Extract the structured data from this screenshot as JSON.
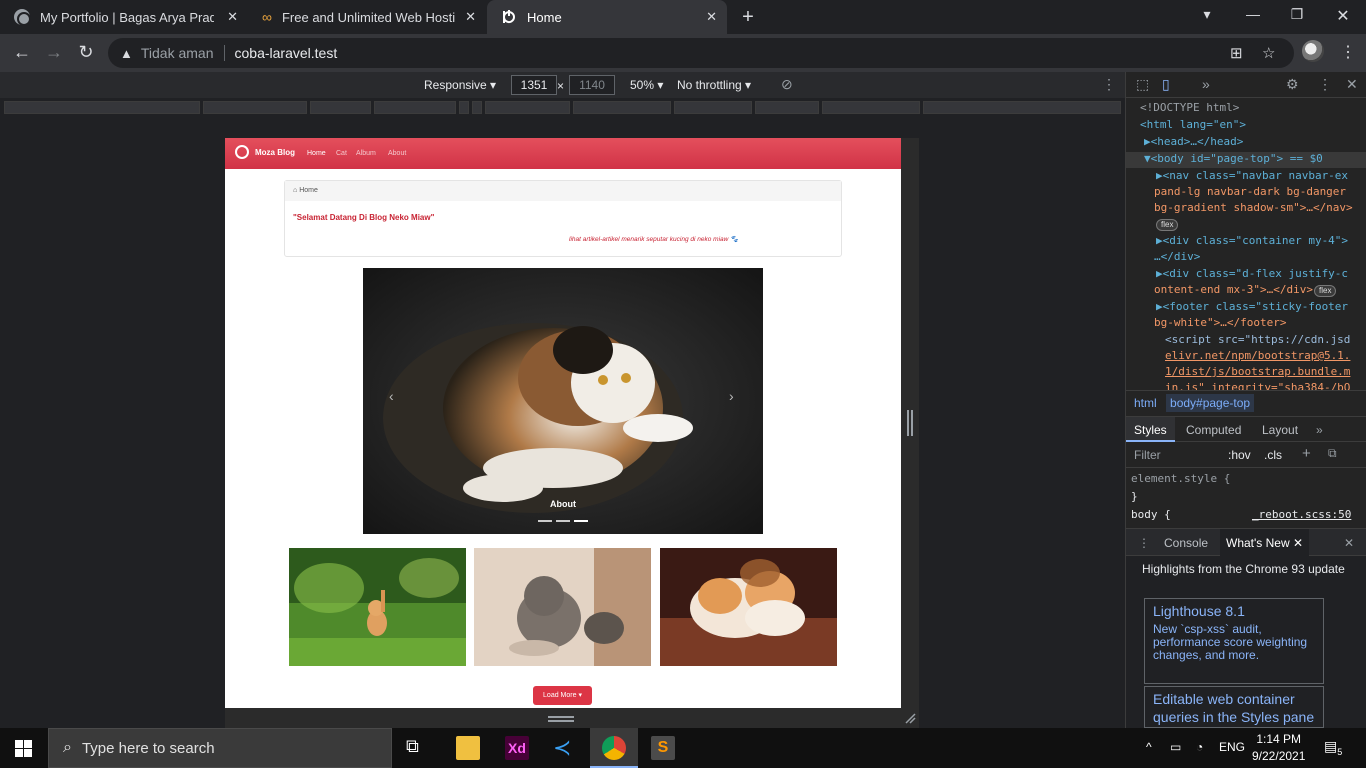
{
  "browser": {
    "tabs": [
      {
        "title": "My Portfolio | Bagas Arya Pradipta"
      },
      {
        "title": "Free and Unlimited Web Hosting"
      },
      {
        "title": "Home"
      }
    ],
    "security_label": "Tidak aman",
    "url": "coba-laravel.test"
  },
  "device_toolbar": {
    "mode": "Responsive",
    "width": "1351",
    "height": "1140",
    "zoom": "50%",
    "throttling": "No throttling"
  },
  "site": {
    "brand": "Moza Blog",
    "nav": [
      {
        "label": "Home",
        "active": true
      },
      {
        "label": "Cat",
        "active": false
      },
      {
        "label": "Album",
        "active": false
      },
      {
        "label": "About",
        "active": false
      }
    ],
    "breadcrumb": "Home",
    "title": "\"Selamat Datang Di Blog Neko Miaw\"",
    "subtitle": "lihat artikel-artikel menarik seputar kucing di neko miaw",
    "carousel_caption": "About",
    "load_more": "Load More"
  },
  "devtools": {
    "elements": [
      "<!DOCTYPE html>",
      "<html lang=\"en\">",
      "▶<head>…</head>",
      "▼<body id=\"page-top\"> == $0",
      "▶<nav class=\"navbar navbar-ex",
      "pand-lg navbar-dark bg-danger",
      "bg-gradient shadow-sm\">…</nav>",
      "flex",
      "▶<div class=\"container my-4\">",
      "…</div>",
      "▶<div class=\"d-flex justify-c",
      "ontent-end mx-3\">…</div>",
      "flex",
      "▶<footer class=\"sticky-footer",
      "bg-white\">…</footer>",
      "<script src=\"https://cdn.jsd",
      "elivr.net/npm/bootstrap@5.1.",
      "1/dist/js/bootstrap.bundle.m",
      "in.js\" integrity=\"sha384-/bQ"
    ],
    "crumbs": [
      "html",
      "body#page-top"
    ],
    "style_tabs": [
      "Styles",
      "Computed",
      "Layout"
    ],
    "filter_placeholder": "Filter",
    "hov": ":hov",
    "cls": ".cls",
    "element_style": "element.style {",
    "close_brace": "}",
    "body_rule": "body {",
    "rule_source": "_reboot.scss:50",
    "drawer_tabs": [
      "Console",
      "What's New"
    ],
    "whats_new_heading": "Highlights from the Chrome 93 update",
    "cards": [
      {
        "title": "Lighthouse 8.1",
        "desc": "New `csp-xss` audit, performance score weighting changes, and more."
      },
      {
        "title": "Editable web container",
        "desc": "queries in the Styles pane"
      }
    ]
  },
  "taskbar": {
    "search_placeholder": "Type here to search",
    "language": "ENG",
    "time": "1:14 PM",
    "date": "9/22/2021",
    "notifications": "5"
  },
  "colors": {
    "brand": "#dc3545",
    "link": "#8ab4f8"
  }
}
